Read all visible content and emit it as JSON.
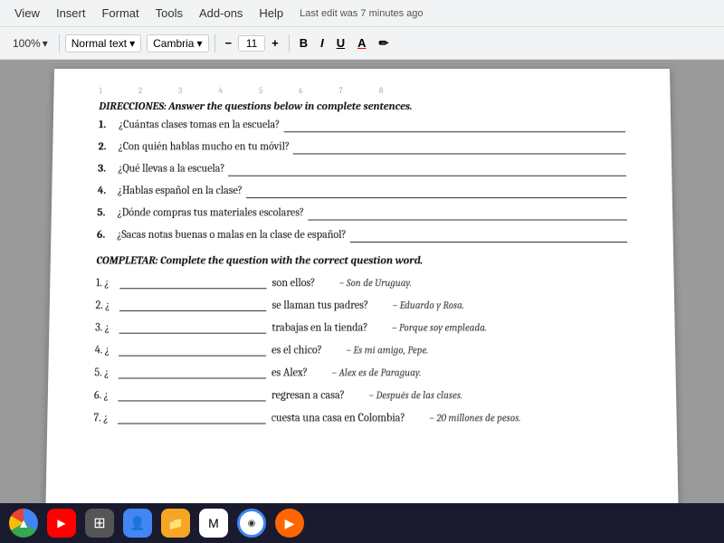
{
  "menubar": {
    "items": [
      "View",
      "Insert",
      "Format",
      "Tools",
      "Add-ons",
      "Help"
    ],
    "last_edit": "Last edit was 7 minutes ago"
  },
  "toolbar": {
    "zoom": "100%",
    "style": "Normal text",
    "font": "Cambria",
    "size": "11",
    "bold": "B",
    "italic": "I",
    "underline": "U",
    "color": "A"
  },
  "document": {
    "section1_title": "DIRECCIONES: Answer the questions below in complete sentences.",
    "questions": [
      {
        "num": "1.",
        "text": "¿Cuántas clases tomas en la escuela?"
      },
      {
        "num": "2.",
        "text": "¿Con quién hablas mucho en tu móvil?"
      },
      {
        "num": "3.",
        "text": "¿Qué llevas a la escuela?"
      },
      {
        "num": "4.",
        "text": "¿Hablas español en la clase?"
      },
      {
        "num": "5.",
        "text": "¿Dónde compras tus materiales escolares?"
      },
      {
        "num": "6.",
        "text": "¿Sacas notas buenas o malas en la clase de español?"
      }
    ],
    "section2_title": "COMPLETAR: Complete the question with the correct question word.",
    "completar": [
      {
        "num": "1.",
        "prefix": "¿",
        "suffix": "son ellos?",
        "answer": "– Son de Uruguay."
      },
      {
        "num": "2.",
        "prefix": "¿",
        "suffix": "se llaman tus padres?",
        "answer": "– Eduardo y Rosa."
      },
      {
        "num": "3.",
        "prefix": "¿",
        "suffix": "trabajas en la tienda?",
        "answer": "– Porque soy empleada."
      },
      {
        "num": "4.",
        "prefix": "¿",
        "suffix": "es el chico?",
        "answer": "– Es mi amigo, Pepe."
      },
      {
        "num": "5.",
        "prefix": "¿",
        "suffix": "es Alex?",
        "answer": "– Alex es de Paraguay."
      },
      {
        "num": "6.",
        "prefix": "¿",
        "suffix": "regresan a casa?",
        "answer": "– Después de las clases."
      },
      {
        "num": "7.",
        "prefix": "¿",
        "suffix": "cuesta una casa en Colombia?",
        "answer": "– 20 millones de pesos."
      }
    ]
  },
  "taskbar": {
    "icons": [
      "drive",
      "youtube",
      "apps",
      "files",
      "folder",
      "gmail",
      "chrome",
      "play"
    ]
  }
}
